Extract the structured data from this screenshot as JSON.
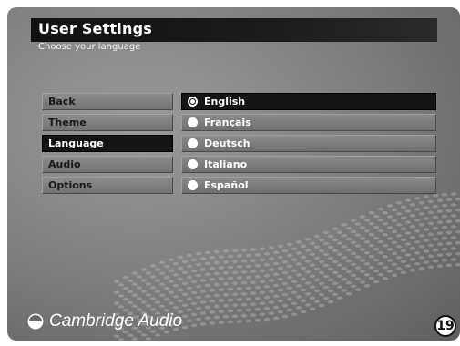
{
  "header": {
    "title": "User Settings",
    "subtitle": "Choose your language"
  },
  "menu": {
    "items": [
      {
        "label": "Back",
        "active": false
      },
      {
        "label": "Theme",
        "active": false
      },
      {
        "label": "Language",
        "active": true
      },
      {
        "label": "Audio",
        "active": false
      },
      {
        "label": "Options",
        "active": false
      }
    ]
  },
  "languages": {
    "selected": "English",
    "options": [
      "English",
      "Français",
      "Deutsch",
      "Italiano",
      "Español"
    ]
  },
  "brand": {
    "name": "Cambridge Audio"
  },
  "page_number": "19",
  "colors": {
    "active_bg": "#141414",
    "button_bg": "#808080",
    "background": "#7c7c7c",
    "text_light": "#ffffff"
  }
}
